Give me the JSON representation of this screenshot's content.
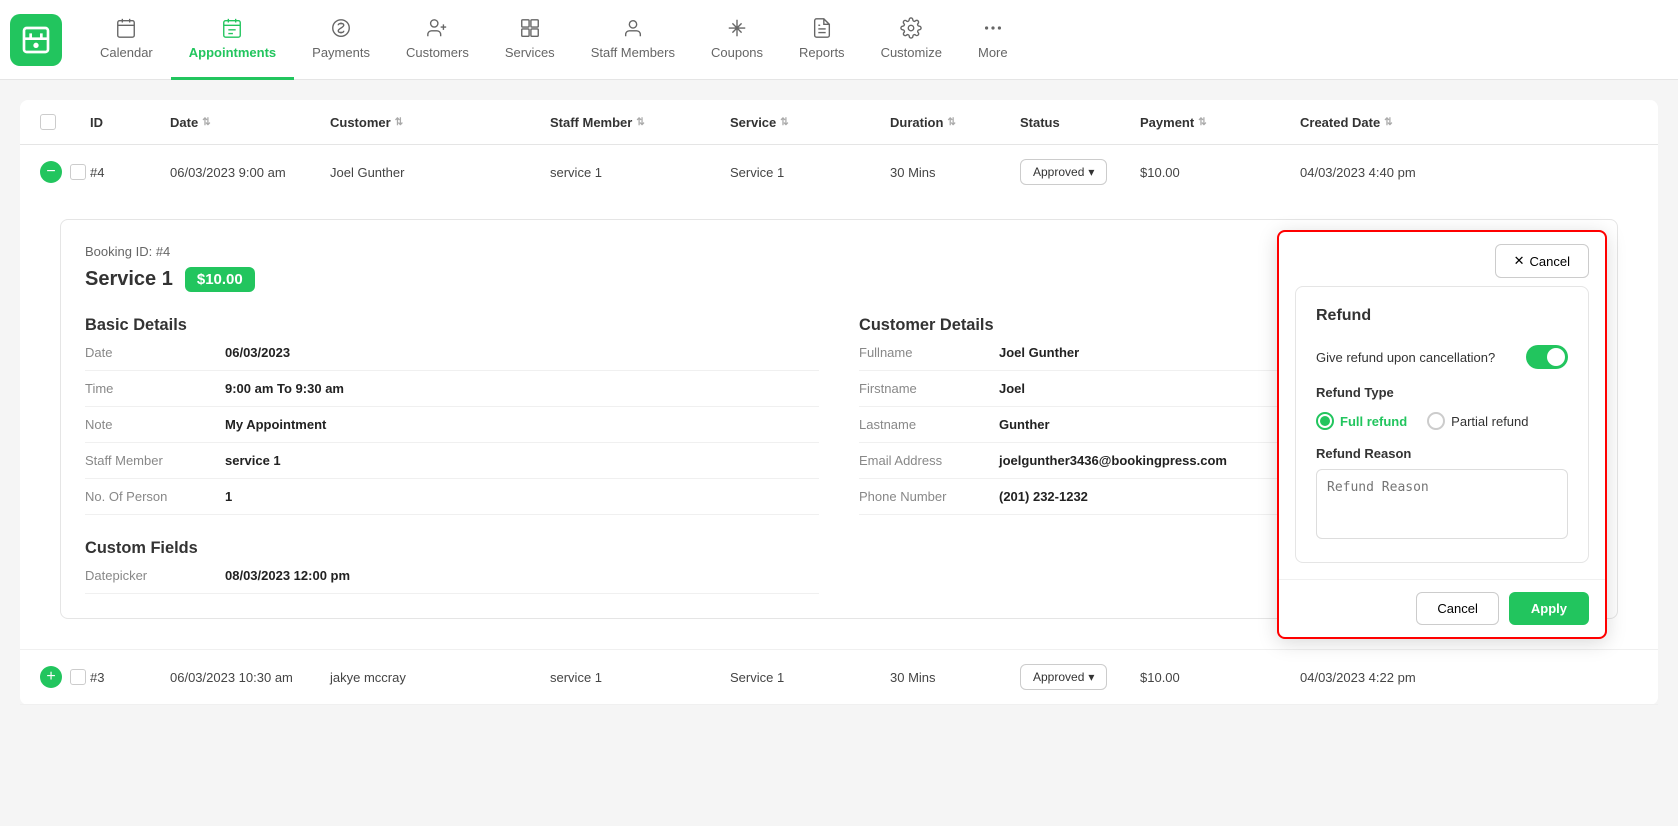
{
  "nav": {
    "items": [
      {
        "id": "calendar",
        "label": "Calendar",
        "active": false
      },
      {
        "id": "appointments",
        "label": "Appointments",
        "active": true
      },
      {
        "id": "payments",
        "label": "Payments",
        "active": false
      },
      {
        "id": "customers",
        "label": "Customers",
        "active": false
      },
      {
        "id": "services",
        "label": "Services",
        "active": false
      },
      {
        "id": "staff-members",
        "label": "Staff Members",
        "active": false
      },
      {
        "id": "coupons",
        "label": "Coupons",
        "active": false
      },
      {
        "id": "reports",
        "label": "Reports",
        "active": false
      },
      {
        "id": "customize",
        "label": "Customize",
        "active": false
      },
      {
        "id": "more",
        "label": "More",
        "active": false
      }
    ]
  },
  "table": {
    "columns": [
      "ID",
      "Date",
      "Customer",
      "Staff Member",
      "Service",
      "Duration",
      "Status",
      "Payment",
      "Created Date"
    ],
    "rows": [
      {
        "id": "#4",
        "date": "06/03/2023 9:00 am",
        "customer": "Joel Gunther",
        "staff_member": "service 1",
        "service": "Service 1",
        "duration": "30 Mins",
        "status": "Approved",
        "payment": "$10.00",
        "created_date": "04/03/2023 4:40 pm",
        "expanded": true
      },
      {
        "id": "#3",
        "date": "06/03/2023 10:30 am",
        "customer": "jakye mccray",
        "staff_member": "service 1",
        "service": "Service 1",
        "duration": "30 Mins",
        "status": "Approved",
        "payment": "$10.00",
        "created_date": "04/03/2023 4:22 pm",
        "expanded": false
      }
    ]
  },
  "booking_detail": {
    "booking_id": "Booking ID: #4",
    "service_name": "Service 1",
    "price": "$10.00",
    "basic_details": {
      "title": "Basic Details",
      "fields": [
        {
          "label": "Date",
          "value": "06/03/2023"
        },
        {
          "label": "Time",
          "value": "9:00 am To 9:30 am"
        },
        {
          "label": "Note",
          "value": "My Appointment"
        },
        {
          "label": "Staff Member",
          "value": "service 1"
        },
        {
          "label": "No. Of Person",
          "value": "1"
        }
      ]
    },
    "custom_fields": {
      "title": "Custom Fields",
      "fields": [
        {
          "label": "Datepicker",
          "value": "08/03/2023 12:00 pm"
        }
      ]
    },
    "customer_details": {
      "title": "Customer Details",
      "fields": [
        {
          "label": "Fullname",
          "value": "Joel Gunther"
        },
        {
          "label": "Firstname",
          "value": "Joel"
        },
        {
          "label": "Lastname",
          "value": "Gunther"
        },
        {
          "label": "Email Address",
          "value": "joelgunther3436@bookingpress.com"
        },
        {
          "label": "Phone Number",
          "value": "(201) 232-1232"
        }
      ]
    }
  },
  "refund_panel": {
    "title": "Refund",
    "cancel_label": "Cancel",
    "give_refund_label": "Give refund upon cancellation?",
    "toggle_on": true,
    "refund_type_label": "Refund Type",
    "full_refund_label": "Full refund",
    "partial_refund_label": "Partial refund",
    "refund_reason_label": "Refund Reason",
    "refund_reason_placeholder": "Refund Reason",
    "cancel_button_label": "Cancel",
    "apply_button_label": "Apply"
  }
}
